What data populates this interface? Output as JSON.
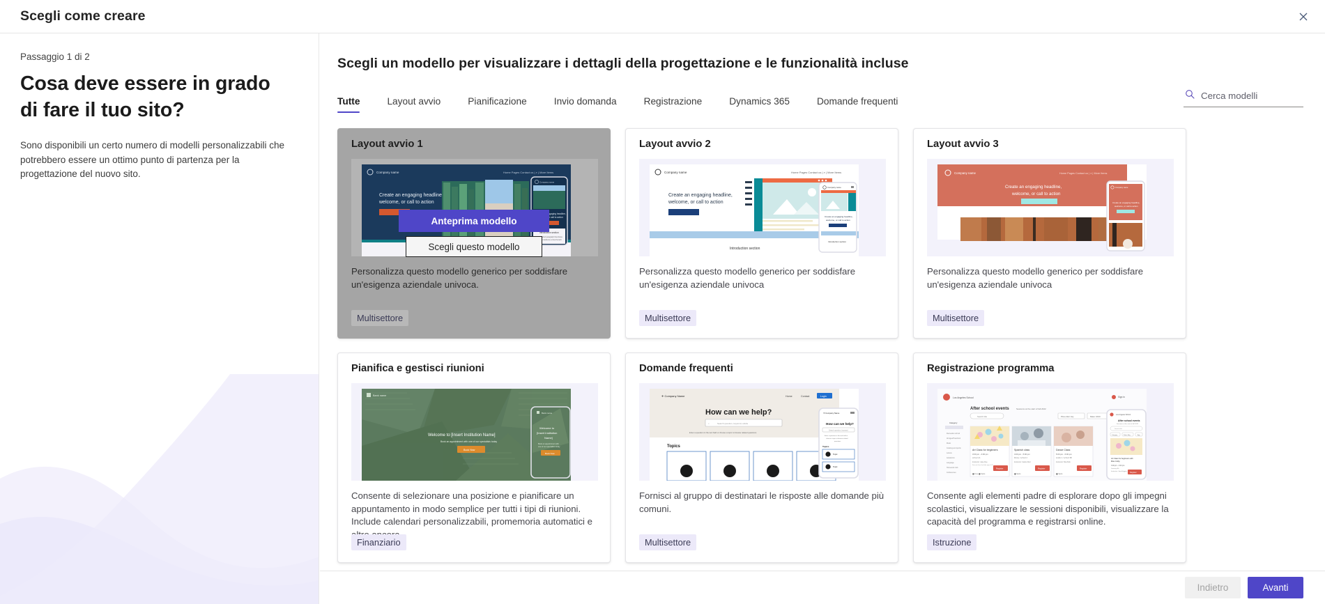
{
  "header": {
    "title": "Scegli come creare",
    "close_icon": "close-icon"
  },
  "left": {
    "step": "Passaggio 1 di 2",
    "heading": "Cosa deve essere in grado di fare il tuo sito?",
    "body": "Sono disponibili un certo numero di modelli personalizzabili che potrebbero essere un ottimo punto di partenza per la progettazione del nuovo sito."
  },
  "main": {
    "title": "Scegli un modello per visualizzare i dettagli della progettazione e le funzionalità incluse",
    "tabs": [
      {
        "label": "Tutte",
        "active": true
      },
      {
        "label": "Layout avvio",
        "active": false
      },
      {
        "label": "Pianificazione",
        "active": false
      },
      {
        "label": "Invio domanda",
        "active": false
      },
      {
        "label": "Registrazione",
        "active": false
      },
      {
        "label": "Dynamics 365",
        "active": false
      },
      {
        "label": "Domande frequenti",
        "active": false
      }
    ],
    "search": {
      "placeholder": "Cerca modelli",
      "value": "",
      "icon": "search-icon"
    },
    "hover_actions": {
      "preview": "Anteprima modello",
      "choose": "Scegli questo modello"
    },
    "cards": [
      {
        "title": "Layout avvio 1",
        "description": "Personalizza questo modello generico per soddisfare un'esigenza aziendale univoca.",
        "tag": "Multisettore",
        "hovered": true,
        "thumb_style": "navy",
        "thumb_headline": "Create an engaging headline, welcome, or call to action",
        "thumb_brand": "Company name"
      },
      {
        "title": "Layout avvio 2",
        "description": "Personalizza questo modello generico per soddisfare un'esigenza aziendale univoca",
        "tag": "Multisettore",
        "hovered": false,
        "thumb_style": "teal",
        "thumb_headline": "Create an engaging headline, welcome, or call to action",
        "thumb_brand": "Company name",
        "thumb_section": "Introduction section"
      },
      {
        "title": "Layout avvio 3",
        "description": "Personalizza questo modello generico per soddisfare un'esigenza aziendale univoca",
        "tag": "Multisettore",
        "hovered": false,
        "thumb_style": "coral",
        "thumb_headline": "Create an engaging headline, welcome, or call to action",
        "thumb_brand": "Company name"
      },
      {
        "title": "Pianifica e gestisci riunioni",
        "description": "Consente di selezionare una posizione e pianificare un appuntamento in modo semplice per tutti i tipi di riunioni. Include calendari personalizzabili, promemoria automatici e altro ancora.",
        "tag": "Finanziario",
        "hovered": false,
        "thumb_style": "green",
        "thumb_headline": "Welcome to [Insert Institution Name]",
        "thumb_sub": "Book an appointment with one of our specialists today",
        "thumb_cta": "Book Now",
        "thumb_brand": "Bank name"
      },
      {
        "title": "Domande frequenti",
        "description": "Fornisci al gruppo di destinatari le risposte alle domande più comuni.",
        "tag": "Multisettore",
        "hovered": false,
        "thumb_style": "faq",
        "thumb_headline": "How can we help?",
        "thumb_sub": "Enter a question in the text field or choose a topic to browse related questions",
        "thumb_topics": "Topics",
        "thumb_brand": "Company Name",
        "thumb_login": "Login"
      },
      {
        "title": "Registrazione programma",
        "description": "Consente agli elementi padre di esplorare dopo gli impegni scolastici, visualizzare le sessioni disponibili, visualizzare la capacità del programma e registrarsi online.",
        "tag": "Istruzione",
        "hovered": false,
        "thumb_style": "school",
        "thumb_headline": "After school events",
        "thumb_brand": "Los Angeles School",
        "thumb_cards": [
          "Art Class for beginners",
          "Spanish class",
          "Dance Class"
        ]
      }
    ]
  },
  "footer": {
    "back": "Indietro",
    "next": "Avanti"
  },
  "colors": {
    "accent": "#4f46c8",
    "tag_bg": "#ece9f9",
    "hover_overlay": "#a5a5a5",
    "deco_wave": "#ece9f9"
  }
}
